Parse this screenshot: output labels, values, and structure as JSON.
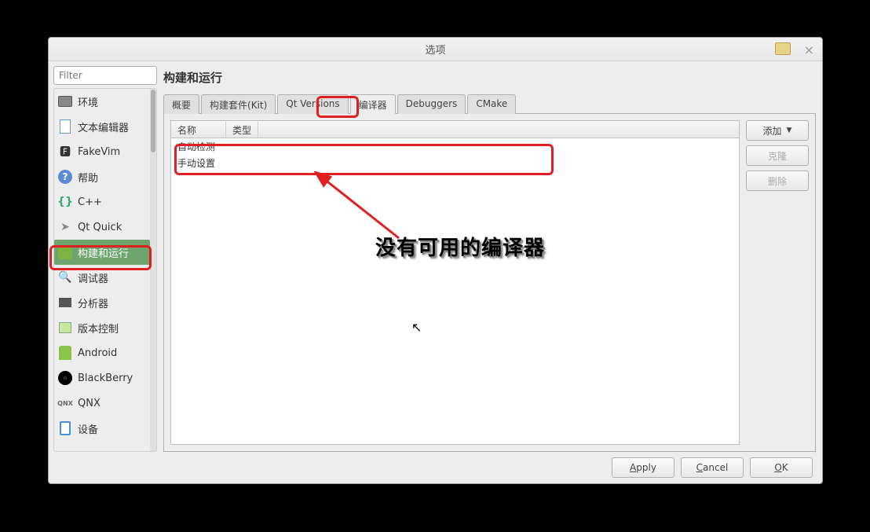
{
  "window": {
    "title": "选项"
  },
  "sidebar": {
    "filter_placeholder": "Filter",
    "items": [
      {
        "label": "环境",
        "icon": "monitor-icon"
      },
      {
        "label": "文本编辑器",
        "icon": "document-icon"
      },
      {
        "label": "FakeVim",
        "icon": "fakevim-icon"
      },
      {
        "label": "帮助",
        "icon": "help-icon"
      },
      {
        "label": "C++",
        "icon": "braces-icon"
      },
      {
        "label": "Qt Quick",
        "icon": "arrow-icon"
      },
      {
        "label": "构建和运行",
        "icon": "qt-icon",
        "selected": true
      },
      {
        "label": "调试器",
        "icon": "debugger-icon"
      },
      {
        "label": "分析器",
        "icon": "grid-icon"
      },
      {
        "label": "版本控制",
        "icon": "folder-icon"
      },
      {
        "label": "Android",
        "icon": "android-icon"
      },
      {
        "label": "BlackBerry",
        "icon": "blackberry-icon"
      },
      {
        "label": "QNX",
        "icon": "qnx-icon"
      },
      {
        "label": "设备",
        "icon": "device-icon"
      }
    ]
  },
  "page": {
    "title": "构建和运行",
    "tabs": [
      {
        "label": "概要"
      },
      {
        "label": "构建套件(Kit)"
      },
      {
        "label": "Qt Versions"
      },
      {
        "label": "编译器",
        "active": true
      },
      {
        "label": "Debuggers"
      },
      {
        "label": "CMake"
      }
    ],
    "table": {
      "columns": {
        "name": "名称",
        "type": "类型"
      },
      "rows": [
        {
          "name": "自动检测"
        },
        {
          "name": "手动设置"
        }
      ]
    },
    "buttons": {
      "add": "添加",
      "clone": "克隆",
      "delete": "删除"
    }
  },
  "footer": {
    "apply": "Apply",
    "cancel": "Cancel",
    "ok": "OK"
  },
  "annotation": {
    "text": "没有可用的编译器"
  }
}
